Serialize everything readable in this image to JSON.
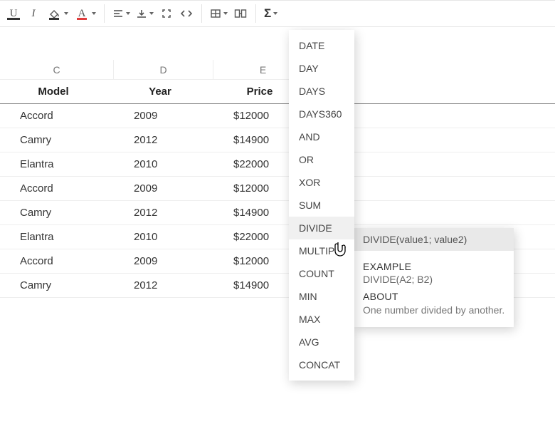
{
  "toolbar": {
    "icons": {
      "underline": "underline",
      "italic": "italic",
      "fillcolor": "fill-color",
      "fontcolor": "font-color",
      "halign": "align-left",
      "valign": "align-bottom",
      "expand": "expand",
      "code": "code",
      "table": "table",
      "splitcell": "split-cell",
      "sigma": "sigma"
    }
  },
  "columns": [
    {
      "letter": "C",
      "header": "Model"
    },
    {
      "letter": "D",
      "header": "Year"
    },
    {
      "letter": "E",
      "header": "Price"
    }
  ],
  "rows": [
    {
      "model": "Accord",
      "year": "2009",
      "price": "$12000"
    },
    {
      "model": "Camry",
      "year": "2012",
      "price": "$14900"
    },
    {
      "model": "Elantra",
      "year": "2010",
      "price": "$22000"
    },
    {
      "model": "Accord",
      "year": "2009",
      "price": "$12000"
    },
    {
      "model": "Camry",
      "year": "2012",
      "price": "$14900"
    },
    {
      "model": "Elantra",
      "year": "2010",
      "price": "$22000"
    },
    {
      "model": "Accord",
      "year": "2009",
      "price": "$12000"
    },
    {
      "model": "Camry",
      "year": "2012",
      "price": "$14900"
    }
  ],
  "fn_menu": {
    "items": [
      "DATE",
      "DAY",
      "DAYS",
      "DAYS360",
      "AND",
      "OR",
      "XOR",
      "SUM",
      "DIVIDE",
      "MULTIPLY",
      "COUNT",
      "MIN",
      "MAX",
      "AVG",
      "CONCAT"
    ],
    "hovered_index": 8
  },
  "tooltip": {
    "signature": "DIVIDE(value1; value2)",
    "example_label": "EXAMPLE",
    "example": "DIVIDE(A2; B2)",
    "about_label": "ABOUT",
    "about": "One number divided by another."
  }
}
